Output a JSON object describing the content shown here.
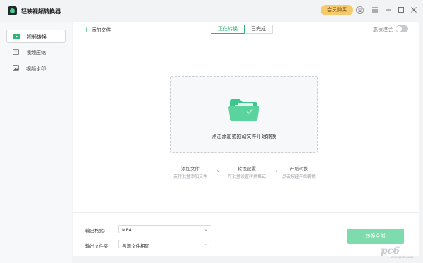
{
  "app": {
    "title": "轻映视频转换器",
    "vip_label": "会员购买"
  },
  "window_controls": [
    "user-icon",
    "menu-icon",
    "minimize-icon",
    "maximize-icon",
    "close-icon"
  ],
  "sidebar": {
    "items": [
      {
        "label": "视频转换",
        "icon": "video-convert-icon",
        "active": true
      },
      {
        "label": "视频压缩",
        "icon": "video-compress-icon",
        "active": false
      },
      {
        "label": "视频水印",
        "icon": "video-watermark-icon",
        "active": false
      }
    ]
  },
  "toolbar": {
    "add_file": "添加文件",
    "tabs": [
      {
        "label": "正在转换",
        "active": true
      },
      {
        "label": "已完成",
        "active": false
      }
    ],
    "fast_mode_label": "高速模式",
    "fast_mode_on": false
  },
  "dropzone": {
    "text": "点击添加或拖动文件开始转换"
  },
  "steps": [
    {
      "title": "添加文件",
      "sub": "支持批量添加文件"
    },
    {
      "title": "转换设置",
      "sub": "可批量设置转换格式"
    },
    {
      "title": "开始转换",
      "sub": "点击按钮开始转换"
    }
  ],
  "bottom": {
    "format_label": "输出格式:",
    "format_value": "MP4",
    "folder_label": "输出文件夹:",
    "folder_value": "与源文件相同",
    "convert_all": "转换全部"
  },
  "watermark": {
    "main": "pc6",
    "sub": "www.pc6.com"
  },
  "colors": {
    "accent": "#2bb673",
    "convert_button": "#7ddbae",
    "vip": "#f6ca6a"
  }
}
